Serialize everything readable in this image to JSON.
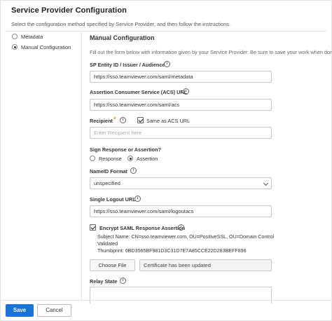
{
  "header": {
    "title": "Service Provider Configuration",
    "subtitle": "Select the configuration method specified by Service Provider, and then follow the instructions."
  },
  "methods": {
    "metadata": "Metadata",
    "manual": "Manual Configuration",
    "selected": "Manual Configuration"
  },
  "manual": {
    "section_title": "Manual Configuration",
    "help_text": "Fill out the form below with information given by your Service Provider. Be sure to save your work when done.",
    "entity_id": {
      "label": "SP Entity ID / Issuer / Audience",
      "value": "https://sso.teamviewer.com/saml/metadata"
    },
    "acs_url": {
      "label": "Assertion Consumer Service (ACS) URL",
      "value": "https://sso.teamviewer.com/saml/acs"
    },
    "recipient": {
      "label": "Recipient",
      "required_mark": "*",
      "same_as_acs_label": "Same as ACS URL",
      "same_as_acs_checked": true,
      "placeholder": "Enter Recipient here"
    },
    "sign": {
      "label": "Sign Response or Assertion?",
      "response": "Response",
      "assertion": "Assertion",
      "selected": "Assertion"
    },
    "nameid": {
      "label": "NameID Format",
      "value": "unspecified"
    },
    "slo": {
      "label": "Single Logout URL",
      "value": "https://sso.teamviewer.com/saml/logoutacs"
    },
    "encrypt": {
      "label": "Encrypt SAML Response Assertion",
      "checked": true,
      "subject": "Subject Name: CN=sso.teamviewer.com, OU=PositiveSSL, OU=Domain Control",
      "subject_cont": "Validated",
      "thumbprint": "Thumbprint: 6BD3565BF981D3C31D7E7A85CCE22D283BEFF896",
      "choose_file": "Choose File",
      "file_status": "Certificate has been updated"
    },
    "relay_state": {
      "label": "Relay State",
      "value": ""
    }
  },
  "footer": {
    "save": "Save",
    "cancel": "Cancel"
  },
  "icons": {
    "info": "i"
  },
  "colors": {
    "primary": "#1a73d9",
    "required": "#e8a21a"
  }
}
